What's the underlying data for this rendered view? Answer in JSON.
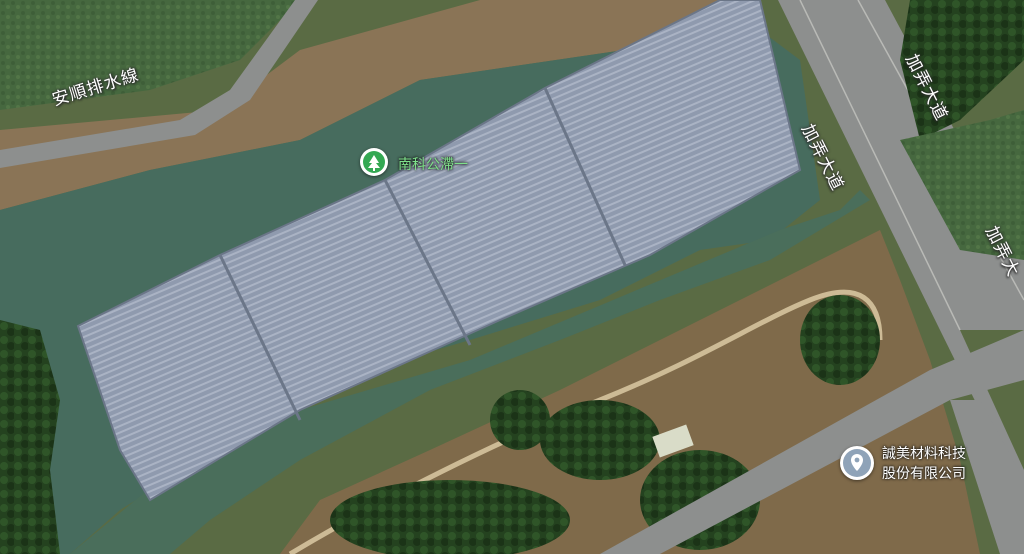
{
  "map": {
    "view": "satellite",
    "labels": {
      "drain": "安順排水線",
      "park": "南科公滯一",
      "avenue_1": "加弄大道",
      "avenue_2": "加弄大道",
      "avenue_3": "加弄大"
    },
    "places": [
      {
        "name": "南科公滯一",
        "icon": "park-tree-icon",
        "color": "#34a853"
      },
      {
        "name_line1": "誠美材料科技",
        "name_line2": "股份有限公司",
        "icon": "location-pin-icon",
        "color": "#8fa3b8"
      }
    ]
  }
}
